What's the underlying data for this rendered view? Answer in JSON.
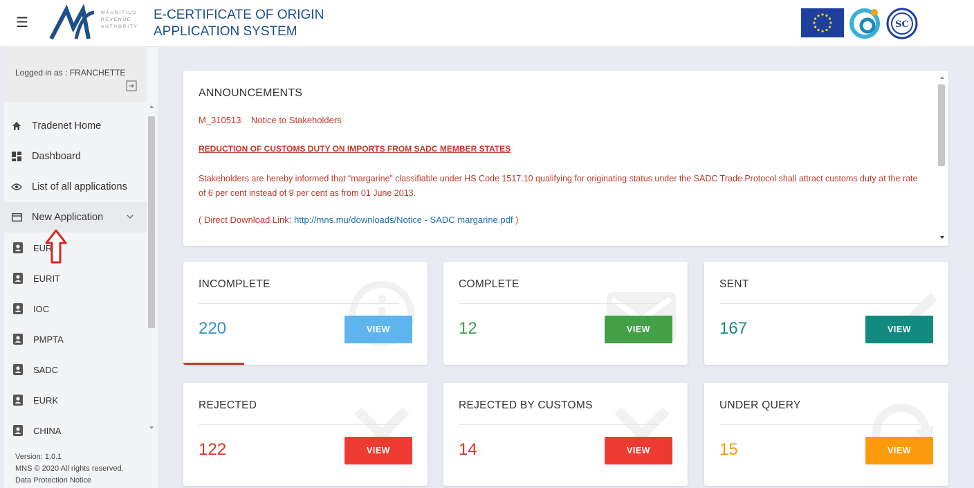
{
  "header": {
    "title_line1": "E-CERTIFICATE OF ORIGIN",
    "title_line2": "APPLICATION SYSTEM",
    "logo_lines": [
      "MAURITIUS",
      "REVENUE",
      "AUTHORITY"
    ],
    "menu_icon": "hamburger-icon",
    "partner_logos": [
      "eu-flag",
      "coi-logo",
      "sadc-logo"
    ]
  },
  "sidebar": {
    "logged_in": "Logged in as : FRANCHETTE",
    "menu": [
      {
        "label": "Tradenet Home",
        "icon": "home-icon"
      },
      {
        "label": "Dashboard",
        "icon": "dashboard-icon"
      },
      {
        "label": "List of all applications",
        "icon": "eye-icon"
      },
      {
        "label": "New Application",
        "icon": "card-icon"
      }
    ],
    "sub_items": [
      "EUR",
      "EURIT",
      "IOC",
      "PMPTA",
      "SADC",
      "EURK",
      "CHINA"
    ],
    "footer": {
      "version": "Version: 1.0.1",
      "copyright": "MNS © 2020 All rights reserved.",
      "data_protection": "Data Protection Notice"
    }
  },
  "announcements": {
    "title": "ANNOUNCEMENTS",
    "notice_ref": "M_310513    Notice to Stakeholders",
    "headline": "REDUCTION OF CUSTOMS DUTY ON IMPORTS FROM SADC MEMBER STATES",
    "body": "Stakeholders are hereby informed that “margarine” classifiable under HS Code 1517.10 qualifying for originating status under the SADC Trade Protocol shall attract customs duty at the rate of 6 per cent instead of 9 per cent as from 01 June 2013.",
    "link_prefix": "( Direct Download Link: ",
    "link_text": "http://mns.mu/downloads/Notice - SADC margarine.pdf",
    "link_suffix": " )"
  },
  "cards": [
    {
      "label": "INCOMPLETE",
      "count": "220",
      "button": "VIEW",
      "count_color": "#3a8fc4",
      "button_color": "#5eb5ee"
    },
    {
      "label": "COMPLETE",
      "count": "12",
      "button": "VIEW",
      "count_color": "#3fa34d",
      "button_color": "#43a047"
    },
    {
      "label": "SENT",
      "count": "167",
      "button": "VIEW",
      "count_color": "#138a82",
      "button_color": "#128a7f"
    },
    {
      "label": "REJECTED",
      "count": "122",
      "button": "VIEW",
      "count_color": "#d9342b",
      "button_color": "#ee3b32"
    },
    {
      "label": "REJECTED BY CUSTOMS",
      "count": "14",
      "button": "VIEW",
      "count_color": "#d9342b",
      "button_color": "#ee3b32"
    },
    {
      "label": "UNDER QUERY",
      "count": "15",
      "button": "VIEW",
      "count_color": "#f49a0a",
      "button_color": "#fb9a0a"
    }
  ]
}
